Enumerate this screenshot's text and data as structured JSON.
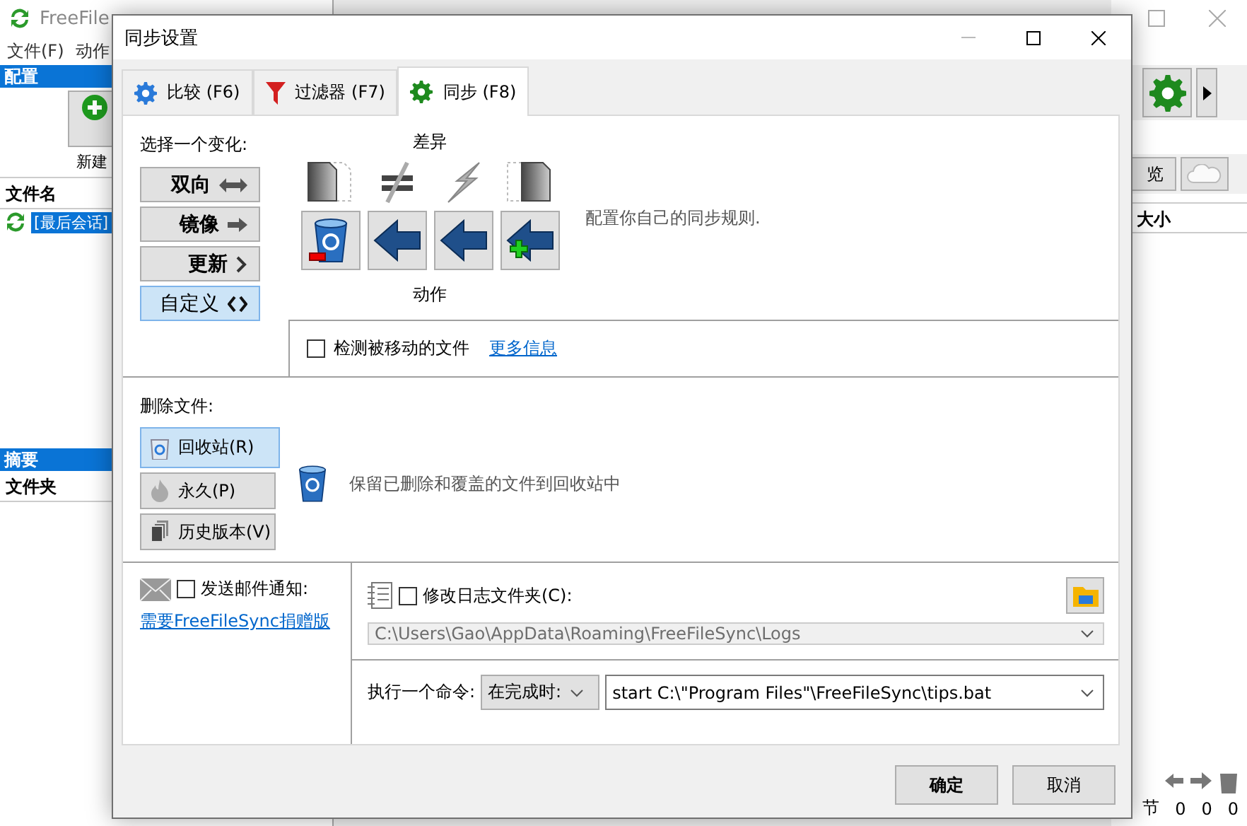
{
  "main_window": {
    "title": "FreeFile",
    "menu": [
      "文件(F)",
      "动作"
    ],
    "config_header": "配置",
    "new_button": "新建",
    "file_header": "文件名",
    "sessions": [
      {
        "label": "[最后会话]",
        "selected": true
      }
    ],
    "summary_header": "摘要",
    "summary_column": "文件夹",
    "view_button": "览",
    "size_column": "大小",
    "status_label": "节",
    "status_counts": [
      "0",
      "0",
      "0"
    ]
  },
  "dialog": {
    "title": "同步设置",
    "tabs": [
      {
        "label": "比较 (F6)",
        "kind": "compare",
        "selected": false
      },
      {
        "label": "过滤器 (F7)",
        "kind": "filter",
        "selected": false
      },
      {
        "label": "同步 (F8)",
        "kind": "sync",
        "selected": true
      }
    ],
    "variant_label": "选择一个变化:",
    "variants": [
      {
        "label": "双向",
        "kind": "two-way",
        "selected": false
      },
      {
        "label": "镜像",
        "kind": "mirror",
        "selected": false
      },
      {
        "label": "更新",
        "kind": "update",
        "selected": false
      },
      {
        "label": "自定义",
        "kind": "custom",
        "selected": true
      }
    ],
    "differences_label": "差异",
    "differences": [
      {
        "kind": "left-only"
      },
      {
        "kind": "different"
      },
      {
        "kind": "conflict"
      },
      {
        "kind": "right-only"
      }
    ],
    "actions": [
      {
        "kind": "delete"
      },
      {
        "kind": "overwrite"
      },
      {
        "kind": "overwrite"
      },
      {
        "kind": "create"
      }
    ],
    "actions_label": "动作",
    "variant_description": "配置你自己的同步规则.",
    "detect_moved": {
      "label": "检测被移动的文件",
      "checked": false
    },
    "more_info_link": "更多信息",
    "delete_label": "删除文件:",
    "delete_options": [
      {
        "label": "回收站(R)",
        "kind": "recycler",
        "selected": true
      },
      {
        "label": "永久(P)",
        "kind": "permanent",
        "selected": false
      },
      {
        "label": "历史版本(V)",
        "kind": "versioning",
        "selected": false
      }
    ],
    "delete_description": "保留已删除和覆盖的文件到回收站中",
    "email": {
      "label": "发送邮件通知:",
      "checked": false
    },
    "donation_link": "需要FreeFileSync捐赠版",
    "log_folder": {
      "label": "修改日志文件夹(C):",
      "checked": false,
      "value": "C:\\Users\\Gao\\AppData\\Roaming\\FreeFileSync\\Logs"
    },
    "command_label": "执行一个命令:",
    "command_when": "在完成时:",
    "command_value": "start C:\\\"Program Files\"\\FreeFileSync\\tips.bat",
    "buttons": [
      {
        "label": "确定",
        "kind": "ok"
      },
      {
        "label": "取消",
        "kind": "cancel"
      }
    ]
  }
}
